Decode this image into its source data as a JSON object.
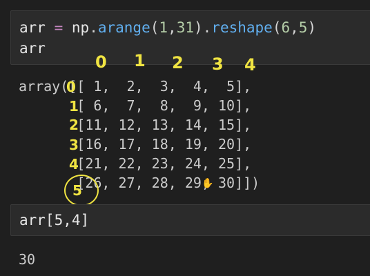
{
  "cell1": {
    "line1": {
      "var": "arr",
      "op": "=",
      "np": "np",
      "dot1": ".",
      "fn1": "arange",
      "open1": "(",
      "n1": "1",
      "comma1": ",",
      "n2": "31",
      "close1": ")",
      "dot2": ".",
      "fn2": "reshape",
      "open2": "(",
      "n3": "6",
      "comma2": ",",
      "n4": "5",
      "close2": ")"
    },
    "line2": "arr"
  },
  "output1": {
    "lines": [
      "array([[ 1,  2,  3,  4,  5],",
      "       [ 6,  7,  8,  9, 10],",
      "       [11, 12, 13, 14, 15],",
      "       [16, 17, 18, 19, 20],",
      "       [21, 22, 23, 24, 25],",
      "       [26, 27, 28, 29, 30]])"
    ]
  },
  "annotations": {
    "col_indices": [
      "0",
      "1",
      "2",
      "3",
      "4"
    ],
    "row_indices": [
      "0",
      "1",
      "2",
      "3",
      "4",
      "5"
    ],
    "color": "#f0e442"
  },
  "cell2": {
    "code": "arr[5,4]"
  },
  "output2": {
    "value": "30"
  }
}
